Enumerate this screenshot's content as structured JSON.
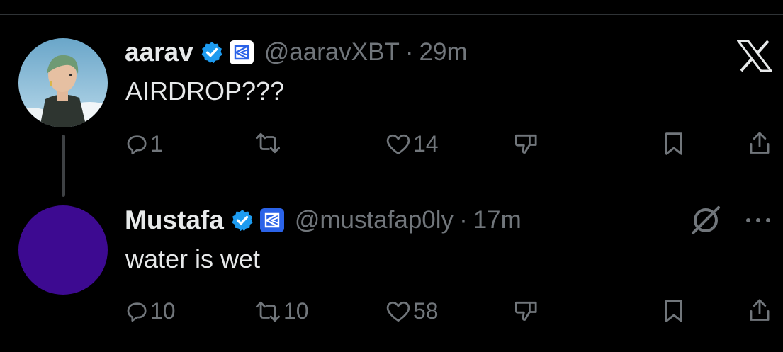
{
  "brand": {
    "icon": "x-logo-icon"
  },
  "tweets": [
    {
      "author": {
        "name": "aarav",
        "handle": "@aaravXBT",
        "verified": true,
        "affiliation_icon": "affiliation-badge-icon"
      },
      "dot": "·",
      "time": "29m",
      "text": "AIRDROP???",
      "actions": {
        "replies": "1",
        "reposts": "",
        "likes": "14"
      }
    },
    {
      "author": {
        "name": "Mustafa",
        "handle": "@mustafap0ly",
        "verified": true,
        "affiliation_icon": "affiliation-badge-icon"
      },
      "dot": "·",
      "time": "17m",
      "text": "water is wet",
      "actions": {
        "replies": "10",
        "reposts": "10",
        "likes": "58"
      }
    }
  ],
  "colors": {
    "background": "#000000",
    "text": "#e7e9ea",
    "muted": "#71767b",
    "verified": "#1d9bf0",
    "avatar2": "#3d0a91"
  }
}
